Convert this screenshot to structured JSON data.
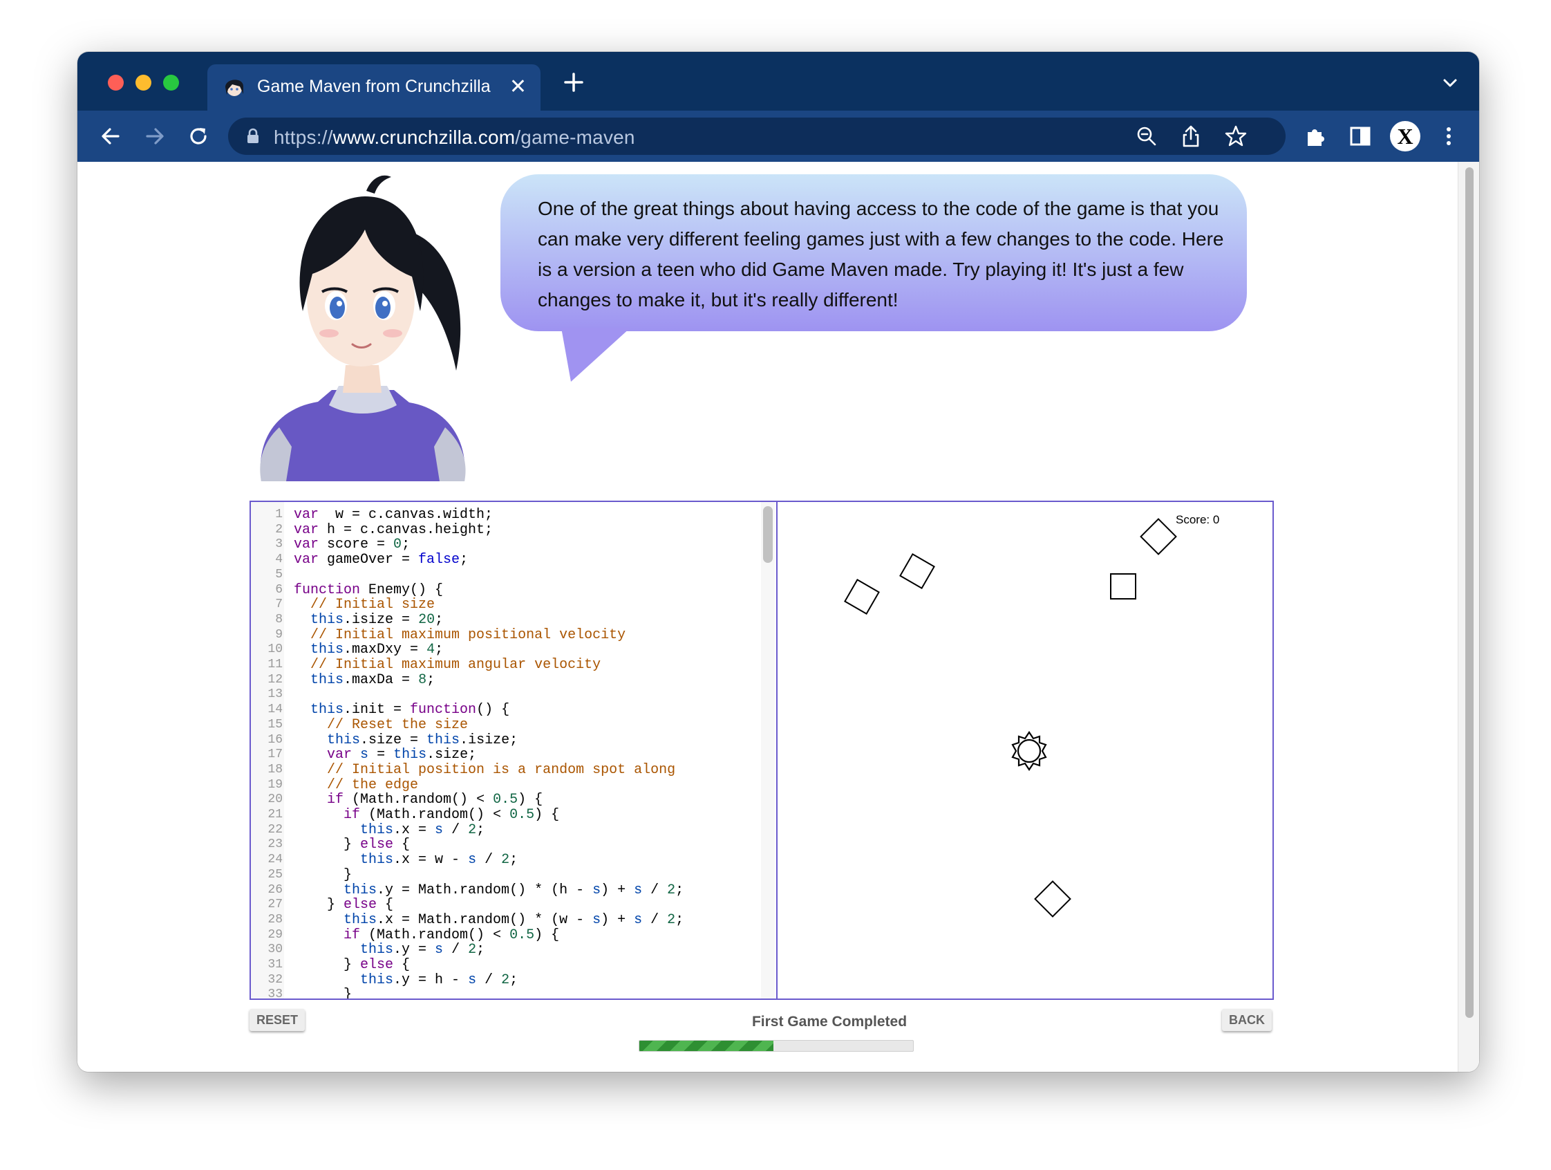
{
  "browser": {
    "tab_title": "Game Maven from Crunchzilla",
    "tab_close": "✕",
    "url_scheme": "https://",
    "url_host": "www.crunchzilla.com",
    "url_path": "/game-maven",
    "profile_initial": "X",
    "traffic_colors": [
      "#fe5f57",
      "#febc2e",
      "#28c840"
    ]
  },
  "guide": {
    "speech": "One of the great things about having access to the code of the game is that you can make very different feeling games just with a few changes to the code. Here is a version a teen who did Game Maven made. Try playing it! It's just a few changes to make it, but it's really different!"
  },
  "editor": {
    "lines": [
      [
        [
          "kw",
          "var"
        ],
        [
          "",
          "  w = c.canvas.width;"
        ]
      ],
      [
        [
          "kw",
          "var"
        ],
        [
          "",
          " h = c.canvas.height;"
        ]
      ],
      [
        [
          "kw",
          "var"
        ],
        [
          "",
          " score = "
        ],
        [
          "nm",
          "0"
        ],
        [
          "",
          ";"
        ]
      ],
      [
        [
          "kw",
          "var"
        ],
        [
          "",
          " gameOver = "
        ],
        [
          "at",
          "false"
        ],
        [
          "",
          ";"
        ]
      ],
      [],
      [
        [
          "kw",
          "function"
        ],
        [
          "",
          " Enemy() {"
        ]
      ],
      [
        [
          "",
          "  "
        ],
        [
          "cm",
          "// Initial size"
        ]
      ],
      [
        [
          "",
          "  "
        ],
        [
          "vr",
          "this"
        ],
        [
          "",
          ".isize = "
        ],
        [
          "nm",
          "20"
        ],
        [
          "",
          ";"
        ]
      ],
      [
        [
          "",
          "  "
        ],
        [
          "cm",
          "// Initial maximum positional velocity"
        ]
      ],
      [
        [
          "",
          "  "
        ],
        [
          "vr",
          "this"
        ],
        [
          "",
          ".maxDxy = "
        ],
        [
          "nm",
          "4"
        ],
        [
          "",
          ";"
        ]
      ],
      [
        [
          "",
          "  "
        ],
        [
          "cm",
          "// Initial maximum angular velocity"
        ]
      ],
      [
        [
          "",
          "  "
        ],
        [
          "vr",
          "this"
        ],
        [
          "",
          ".maxDa = "
        ],
        [
          "nm",
          "8"
        ],
        [
          "",
          ";"
        ]
      ],
      [],
      [
        [
          "",
          "  "
        ],
        [
          "vr",
          "this"
        ],
        [
          "",
          ".init = "
        ],
        [
          "kw",
          "function"
        ],
        [
          "",
          "() {"
        ]
      ],
      [
        [
          "",
          "    "
        ],
        [
          "cm",
          "// Reset the size"
        ]
      ],
      [
        [
          "",
          "    "
        ],
        [
          "vr",
          "this"
        ],
        [
          "",
          ".size = "
        ],
        [
          "vr",
          "this"
        ],
        [
          "",
          ".isize;"
        ]
      ],
      [
        [
          "",
          "    "
        ],
        [
          "kw",
          "var"
        ],
        [
          "",
          " "
        ],
        [
          "vr",
          "s"
        ],
        [
          "",
          " = "
        ],
        [
          "vr",
          "this"
        ],
        [
          "",
          ".size;"
        ]
      ],
      [
        [
          "",
          "    "
        ],
        [
          "cm",
          "// Initial position is a random spot along"
        ]
      ],
      [
        [
          "",
          "    "
        ],
        [
          "cm",
          "// the edge"
        ]
      ],
      [
        [
          "",
          "    "
        ],
        [
          "kw",
          "if"
        ],
        [
          "",
          " (Math.random() < "
        ],
        [
          "nm",
          "0.5"
        ],
        [
          "",
          ") {"
        ]
      ],
      [
        [
          "",
          "      "
        ],
        [
          "kw",
          "if"
        ],
        [
          "",
          " (Math.random() < "
        ],
        [
          "nm",
          "0.5"
        ],
        [
          "",
          ") {"
        ]
      ],
      [
        [
          "",
          "        "
        ],
        [
          "vr",
          "this"
        ],
        [
          "",
          ".x = "
        ],
        [
          "vr",
          "s"
        ],
        [
          "",
          " / "
        ],
        [
          "nm",
          "2"
        ],
        [
          "",
          ";"
        ]
      ],
      [
        [
          "",
          "      } "
        ],
        [
          "kw",
          "else"
        ],
        [
          "",
          " {"
        ]
      ],
      [
        [
          "",
          "        "
        ],
        [
          "vr",
          "this"
        ],
        [
          "",
          ".x = w - "
        ],
        [
          "vr",
          "s"
        ],
        [
          "",
          " / "
        ],
        [
          "nm",
          "2"
        ],
        [
          "",
          ";"
        ]
      ],
      [
        [
          "",
          "      }"
        ]
      ],
      [
        [
          "",
          "      "
        ],
        [
          "vr",
          "this"
        ],
        [
          "",
          ".y = Math.random() * (h - "
        ],
        [
          "vr",
          "s"
        ],
        [
          "",
          ") + "
        ],
        [
          "vr",
          "s"
        ],
        [
          "",
          " / "
        ],
        [
          "nm",
          "2"
        ],
        [
          "",
          ";"
        ]
      ],
      [
        [
          "",
          "    } "
        ],
        [
          "kw",
          "else"
        ],
        [
          "",
          " {"
        ]
      ],
      [
        [
          "",
          "      "
        ],
        [
          "vr",
          "this"
        ],
        [
          "",
          ".x = Math.random() * (w - "
        ],
        [
          "vr",
          "s"
        ],
        [
          "",
          ") + "
        ],
        [
          "vr",
          "s"
        ],
        [
          "",
          " / "
        ],
        [
          "nm",
          "2"
        ],
        [
          "",
          ";"
        ]
      ],
      [
        [
          "",
          "      "
        ],
        [
          "kw",
          "if"
        ],
        [
          "",
          " (Math.random() < "
        ],
        [
          "nm",
          "0.5"
        ],
        [
          "",
          ") {"
        ]
      ],
      [
        [
          "",
          "        "
        ],
        [
          "vr",
          "this"
        ],
        [
          "",
          ".y = "
        ],
        [
          "vr",
          "s"
        ],
        [
          "",
          " / "
        ],
        [
          "nm",
          "2"
        ],
        [
          "",
          ";"
        ]
      ],
      [
        [
          "",
          "      } "
        ],
        [
          "kw",
          "else"
        ],
        [
          "",
          " {"
        ]
      ],
      [
        [
          "",
          "        "
        ],
        [
          "vr",
          "this"
        ],
        [
          "",
          ".y = h - "
        ],
        [
          "vr",
          "s"
        ],
        [
          "",
          " / "
        ],
        [
          "nm",
          "2"
        ],
        [
          "",
          ";"
        ]
      ],
      [
        [
          "",
          "      }"
        ]
      ]
    ]
  },
  "game": {
    "score_text": "Score: 0",
    "enemy_angles_deg": [
      30,
      30,
      0,
      45,
      45
    ],
    "player_shape": "star-ring"
  },
  "controls": {
    "reset_label": "RESET",
    "back_label": "BACK",
    "status_text": "First Game Completed",
    "progress": 0.49
  }
}
